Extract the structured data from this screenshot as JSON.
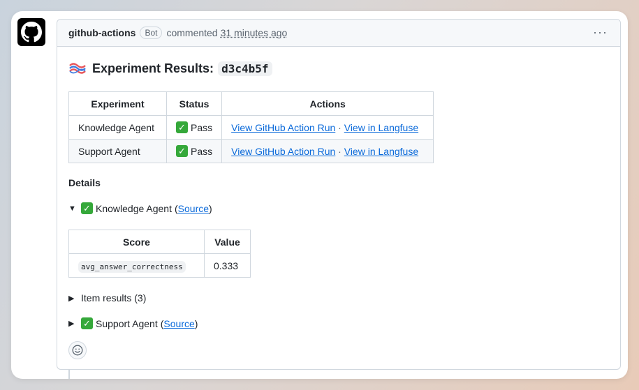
{
  "comment": {
    "author": "github-actions",
    "badge": "Bot",
    "action": "commented",
    "time": "31 minutes ago"
  },
  "heading": {
    "title": "Experiment Results:",
    "hash": "d3c4b5f"
  },
  "results_table": {
    "headers": [
      "Experiment",
      "Status",
      "Actions"
    ],
    "rows": [
      {
        "experiment": "Knowledge Agent",
        "status": "Pass",
        "link1": "View GitHub Action Run",
        "sep": "·",
        "link2": "View in Langfuse"
      },
      {
        "experiment": "Support Agent",
        "status": "Pass",
        "link1": "View GitHub Action Run",
        "sep": "·",
        "link2": "View in Langfuse"
      }
    ]
  },
  "details": {
    "label": "Details",
    "knowledge": {
      "name": "Knowledge Agent",
      "open": "(",
      "source": "Source",
      "close": ")"
    },
    "score_table": {
      "headers": [
        "Score",
        "Value"
      ],
      "rows": [
        {
          "score": "avg_answer_correctness",
          "value": "0.333"
        }
      ]
    },
    "item_results": "Item results (3)",
    "support": {
      "name": "Support Agent",
      "open": "(",
      "source": "Source",
      "close": ")"
    }
  },
  "icons": {
    "avatar": "github-logo-icon",
    "more": "kebab-icon",
    "emoji": "smiley-icon",
    "pass": "check-mark-icon",
    "langfuse": "langfuse-logo-icon"
  },
  "colors": {
    "link": "#0969da",
    "check": "#35a83a",
    "border": "#d0d7de"
  }
}
